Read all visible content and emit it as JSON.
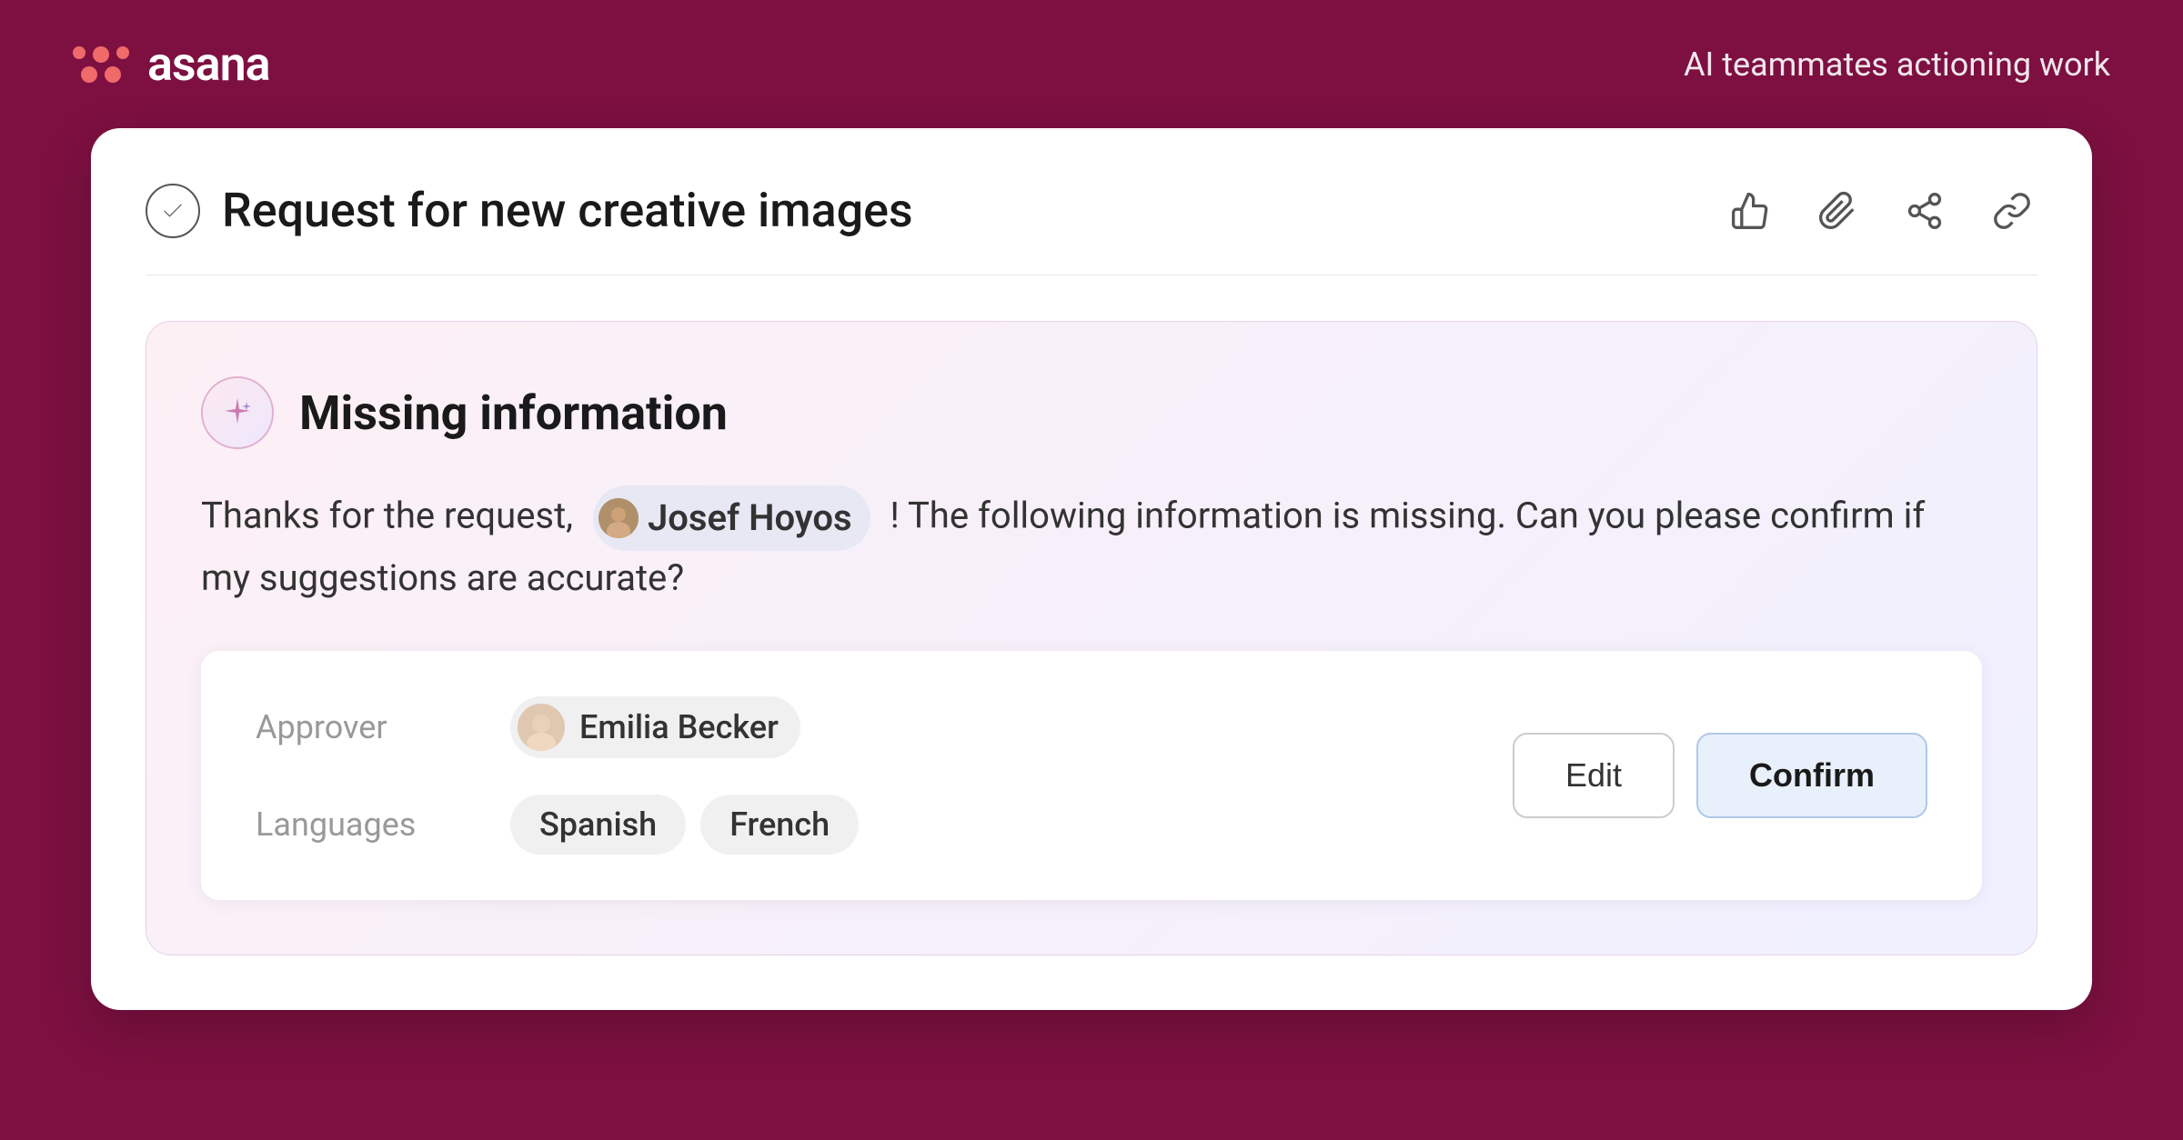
{
  "app": {
    "tagline": "AI teammates actioning work"
  },
  "logo": {
    "text": "asana"
  },
  "task": {
    "title": "Request for new creative images",
    "actions": [
      "thumbs-up",
      "paperclip",
      "share",
      "link"
    ]
  },
  "ai_panel": {
    "title": "Missing information",
    "message_before": "Thanks for the request,",
    "user": {
      "name": "Josef Hoyos"
    },
    "message_after": "! The following information is missing. Can you please confirm if my suggestions are accurate?",
    "approver_label": "Approver",
    "approver_name": "Emilia Becker",
    "languages_label": "Languages",
    "languages": [
      "Spanish",
      "French"
    ],
    "edit_button": "Edit",
    "confirm_button": "Confirm"
  }
}
